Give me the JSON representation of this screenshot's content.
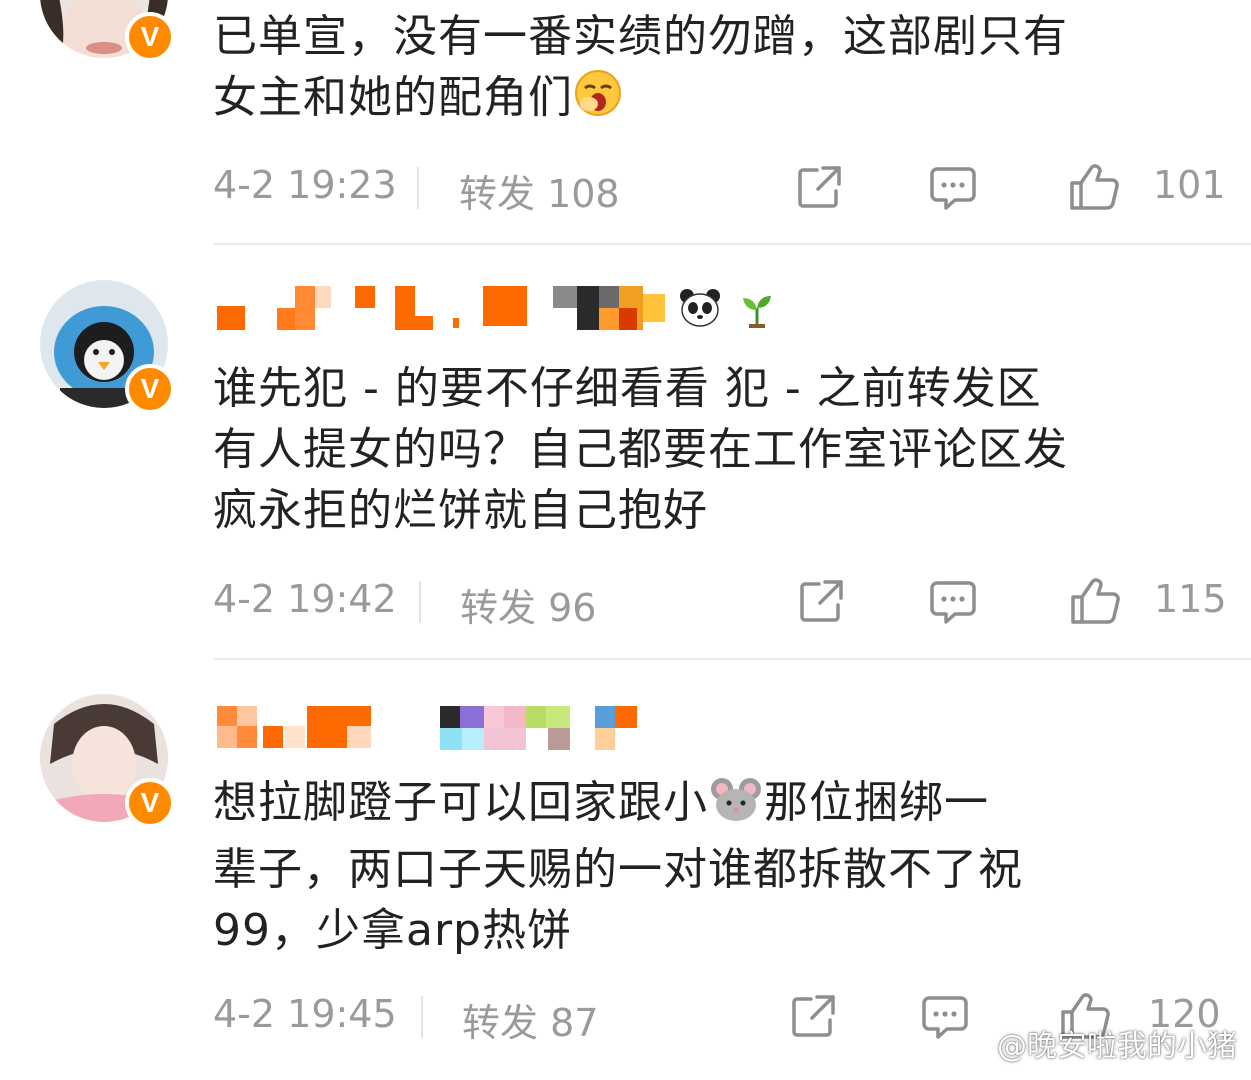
{
  "comments": [
    {
      "text_line1": "已单宣，没有一番实绩的勿蹭，这部剧只有",
      "text_line2": "女主和她的配角们",
      "time": "4-2 19:23",
      "repost_label": "转发 108",
      "likes": "101"
    },
    {
      "text_line1": "谁先犯 - 的要不仔细看看 犯 - 之前转发区",
      "text_line2": "有人提女的吗？自己都要在工作室评论区发",
      "text_line3": "疯永拒的烂饼就自己抱好",
      "time": "4-2 19:42",
      "repost_label": "转发 96",
      "likes": "115"
    },
    {
      "text_line1a": "想拉脚蹬子可以回家跟小",
      "text_line1b": "那位捆绑一",
      "text_line2": "辈子，两口子天赐的一对谁都拆散不了祝",
      "text_line3": "99，少拿arp热饼",
      "time": "4-2 19:45",
      "repost_label": "转发 87",
      "likes": "120"
    }
  ],
  "badge_letter": "V",
  "watermark": "@晚安啦我的小猪",
  "colors": {
    "accent": "#ff8a00",
    "text": "#222222",
    "meta": "#9a9a9a"
  },
  "icons": [
    "share-icon",
    "comment-icon",
    "like-icon",
    "verified-icon",
    "panda-emoji",
    "sprout-emoji",
    "yawn-emoji",
    "mouse-emoji",
    "weibo-logo-icon"
  ]
}
